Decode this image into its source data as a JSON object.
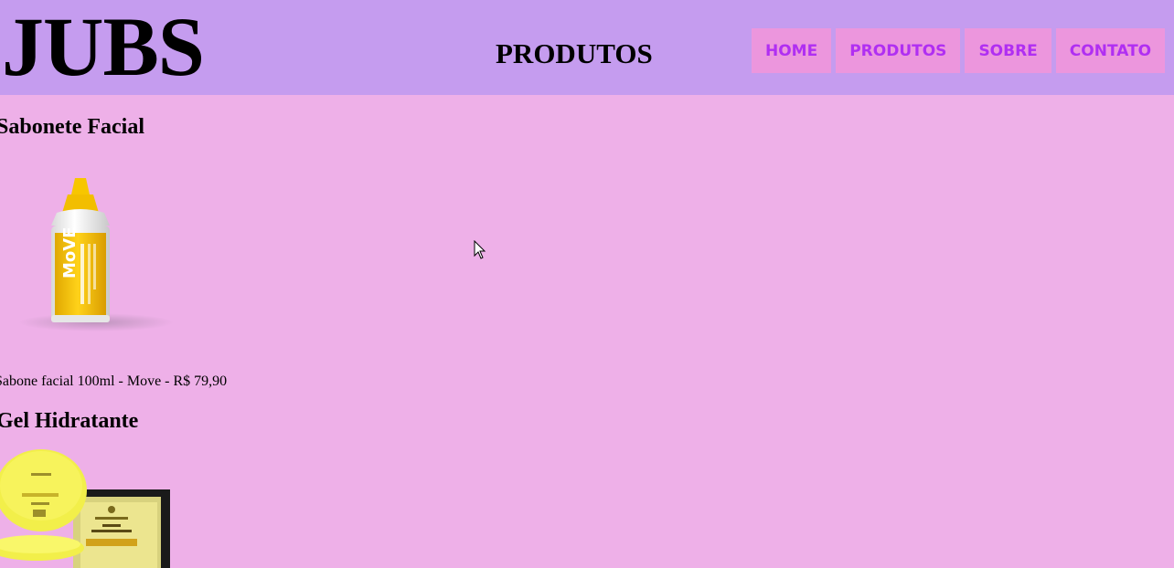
{
  "header": {
    "logo": "JUBS",
    "page_title": "PRODUTOS",
    "nav": [
      {
        "label": "HOME"
      },
      {
        "label": "PRODUTOS"
      },
      {
        "label": "SOBRE"
      },
      {
        "label": "CONTATO"
      }
    ]
  },
  "products": [
    {
      "title": "Sabonete Facial",
      "description": "Sabone facial 100ml - Move - R$ 79,90",
      "image_icon": "yellow-bottle-image"
    },
    {
      "title": "Gel Hidratante",
      "image_icon": "gel-jar-image"
    }
  ],
  "colors": {
    "header_bg": "#c59cef",
    "page_bg": "#eeb0e8",
    "nav_bg": "#ec96dd",
    "nav_text": "#b02ff2"
  }
}
